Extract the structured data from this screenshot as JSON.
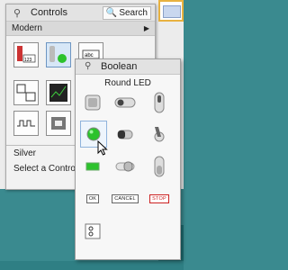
{
  "controls_palette": {
    "title": "Controls",
    "search_label": "Search",
    "category": "Modern",
    "subcategory": "Silver",
    "select_control": "Select a Control..."
  },
  "boolean_palette": {
    "title": "Boolean",
    "hover_label": "Round LED",
    "buttons": {
      "ok": "OK",
      "cancel": "CANCEL",
      "stop": "STOP"
    }
  },
  "accent_colors": {
    "desktop": "#3a8a8f",
    "selection": "#8fb3dc",
    "led_green": "#2cc22c"
  }
}
